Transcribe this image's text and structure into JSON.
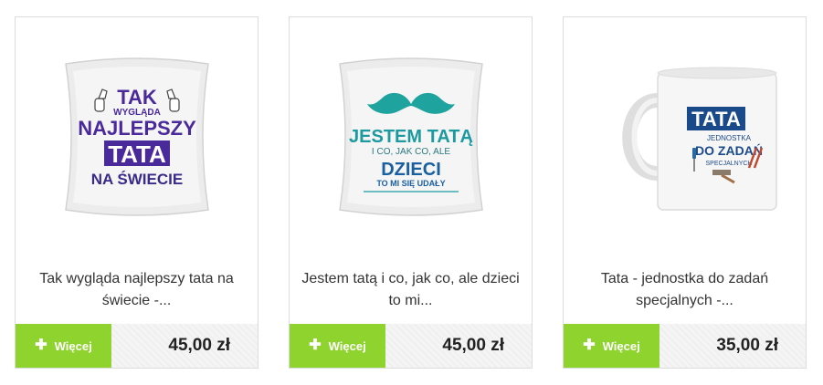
{
  "products": [
    {
      "title": "Tak wygląda najlepszy tata na świecie -...",
      "more_label": "Więcej",
      "price": "45,00 zł",
      "art": {
        "line1": "TAK",
        "line2": "WYGLĄDA",
        "line3": "NAJLEPSZY",
        "line4": "TATA",
        "line5": "NA ŚWIECIE"
      },
      "colors": {
        "accent": "#4a2a9a"
      }
    },
    {
      "title": "Jestem tatą i co, jak co, ale dzieci to mi...",
      "more_label": "Więcej",
      "price": "45,00 zł",
      "art": {
        "line1": "JESTEM TATĄ",
        "line2": "I CO, JAK CO, ALE",
        "line3": "DZIECI",
        "line4": "TO MI SIĘ UDAŁY"
      },
      "colors": {
        "accent": "#1c9aa0"
      }
    },
    {
      "title": "Tata - jednostka do zadań specjalnych -...",
      "more_label": "Więcej",
      "price": "35,00 zł",
      "art": {
        "line1": "TATA",
        "line2": "JEDNOSTKA",
        "line3": "DO ZADAŃ",
        "line4": "SPECJALNYCH"
      },
      "colors": {
        "accent": "#1a4a8a"
      }
    }
  ],
  "colors": {
    "button": "#8fd32e",
    "border": "#dcdcdc"
  },
  "icons": {
    "more": "plus-icon"
  }
}
